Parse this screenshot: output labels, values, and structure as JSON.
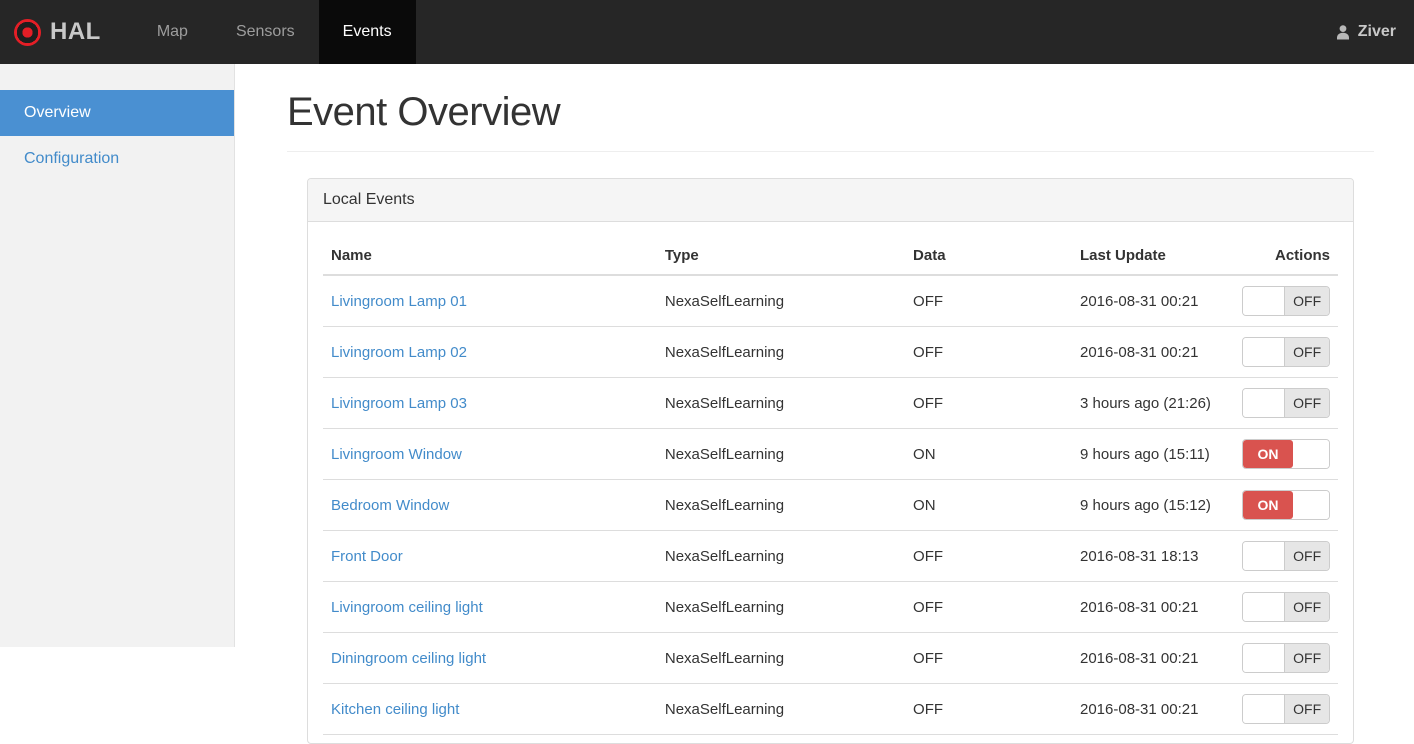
{
  "navbar": {
    "brand": "HAL",
    "items": [
      {
        "label": "Map",
        "active": false
      },
      {
        "label": "Sensors",
        "active": false
      },
      {
        "label": "Events",
        "active": true
      }
    ],
    "user": {
      "icon": "person-icon",
      "name": "Ziver"
    }
  },
  "sidebar": {
    "items": [
      {
        "label": "Overview",
        "active": true
      },
      {
        "label": "Configuration",
        "active": false
      }
    ]
  },
  "main": {
    "title": "Event Overview",
    "panel": {
      "title": "Local Events",
      "table": {
        "columns": [
          "Name",
          "Type",
          "Data",
          "Last Update",
          "Actions"
        ],
        "rows": [
          {
            "name": "Livingroom Lamp 01",
            "type": "NexaSelfLearning",
            "data": "OFF",
            "last_update": "2016-08-31 00:21",
            "toggle": "OFF"
          },
          {
            "name": "Livingroom Lamp 02",
            "type": "NexaSelfLearning",
            "data": "OFF",
            "last_update": "2016-08-31 00:21",
            "toggle": "OFF"
          },
          {
            "name": "Livingroom Lamp 03",
            "type": "NexaSelfLearning",
            "data": "OFF",
            "last_update": "3 hours ago (21:26)",
            "toggle": "OFF"
          },
          {
            "name": "Livingroom Window",
            "type": "NexaSelfLearning",
            "data": "ON",
            "last_update": "9 hours ago (15:11)",
            "toggle": "ON"
          },
          {
            "name": "Bedroom Window",
            "type": "NexaSelfLearning",
            "data": "ON",
            "last_update": "9 hours ago (15:12)",
            "toggle": "ON"
          },
          {
            "name": "Front Door",
            "type": "NexaSelfLearning",
            "data": "OFF",
            "last_update": "2016-08-31 18:13",
            "toggle": "OFF"
          },
          {
            "name": "Livingroom ceiling light",
            "type": "NexaSelfLearning",
            "data": "OFF",
            "last_update": "2016-08-31 00:21",
            "toggle": "OFF"
          },
          {
            "name": "Diningroom ceiling light",
            "type": "NexaSelfLearning",
            "data": "OFF",
            "last_update": "2016-08-31 00:21",
            "toggle": "OFF"
          },
          {
            "name": "Kitchen ceiling light",
            "type": "NexaSelfLearning",
            "data": "OFF",
            "last_update": "2016-08-31 00:21",
            "toggle": "OFF"
          }
        ]
      }
    }
  },
  "colors": {
    "navbar_bg": "#262626",
    "navbar_active_bg": "#0a0a0a",
    "sidebar_active_blue": "#4a90d2",
    "link_blue": "#428bca",
    "toggle_on_red": "#d9534f",
    "logo_red": "#e41e26"
  }
}
